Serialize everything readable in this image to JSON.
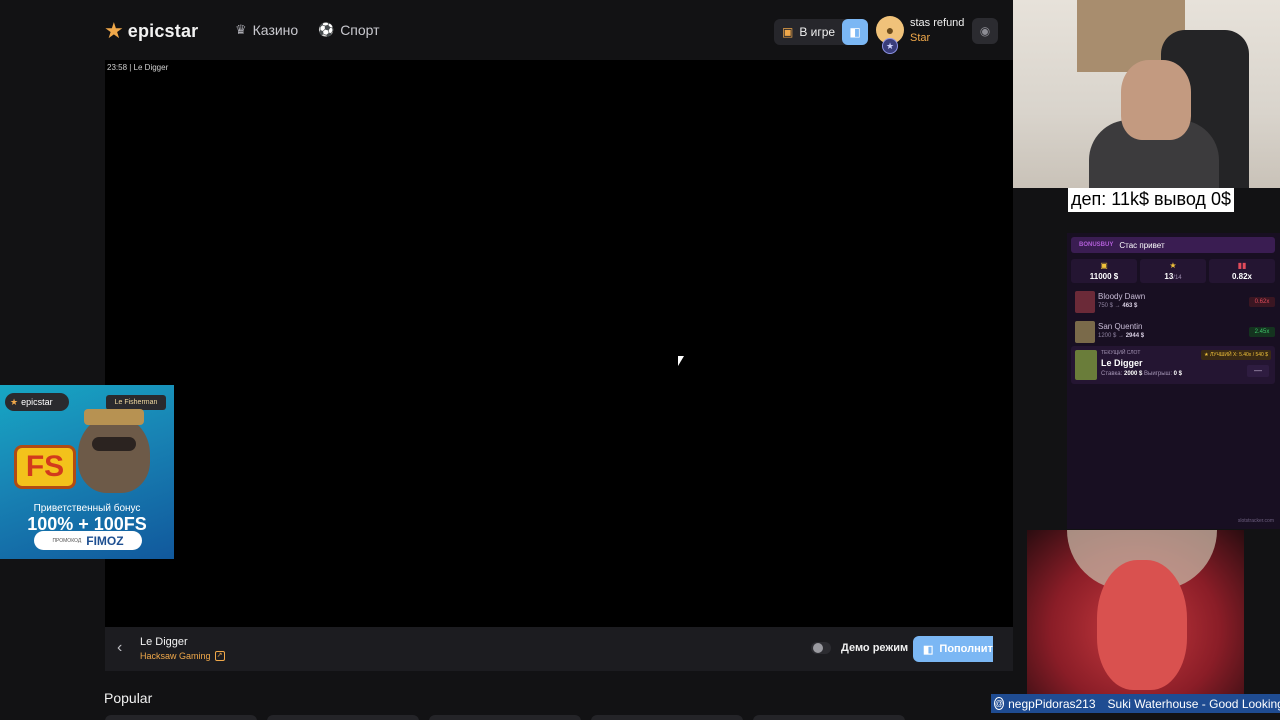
{
  "header": {
    "logo_text": "epicstar",
    "nav": [
      {
        "label": "Казино",
        "icon": "crown-icon"
      },
      {
        "label": "Спорт",
        "icon": "ball-icon"
      }
    ],
    "in_game_label": "В игре",
    "user": {
      "name": "stas refund",
      "rank": "Star"
    }
  },
  "game": {
    "caption": "23:58 | Le Digger",
    "title": "Le Digger",
    "provider": "Hacksaw Gaming",
    "demo_label": "Демо режим",
    "deposit_label": "Пополнит"
  },
  "section": {
    "popular_label": "Popular"
  },
  "promo": {
    "brand": "epicstar",
    "game_name": "Le Fisherman",
    "fs_text": "FS",
    "line1": "Приветственный бонус",
    "line2": "100% + 100FS",
    "promo_label": "ПРОМОКОД",
    "promo_code": "FIMOZ"
  },
  "overlay": {
    "dep_text": "деп: 11k$ вывод 0$"
  },
  "tracker": {
    "tag": "BONUSBUY",
    "title": "Стас привет",
    "stats": [
      {
        "icon": "coin-icon",
        "value": "11000 $",
        "sub": ""
      },
      {
        "icon": "star-icon",
        "value": "13",
        "sub": "/14"
      },
      {
        "icon": "chart-icon",
        "value": "0.82x",
        "sub": ""
      }
    ],
    "slots": [
      {
        "name": "Bloody Dawn",
        "bet": "750 $",
        "win": "463 $",
        "mult": "0.62x",
        "color": "#6b2a38",
        "mult_color": "#e24b5b",
        "mult_bg": "#3a1622"
      },
      {
        "name": "San Quentin",
        "bet": "1200 $",
        "win": "2944 $",
        "mult": "2.45x",
        "color": "#7a6a4a",
        "mult_color": "#3fc46a",
        "mult_bg": "#14331f"
      }
    ],
    "current": {
      "label": "ТЕКУЩИЙ СЛОТ",
      "name": "Le Digger",
      "bet_label": "Ставка:",
      "bet": "2000 $",
      "win_label": "Выигрыш:",
      "win": "0 $",
      "best": "★ ЛУЧШИЙ X: 5.40x / 540 $",
      "dash": "—"
    },
    "footer": "slotstracker.com"
  },
  "chat": {
    "user": "negpPidoras213",
    "message": "Suki Waterhouse - Good Looking"
  },
  "colors": {
    "accent": "#f0a84a",
    "button_blue": "#7bb7f4",
    "background": "#121214"
  }
}
